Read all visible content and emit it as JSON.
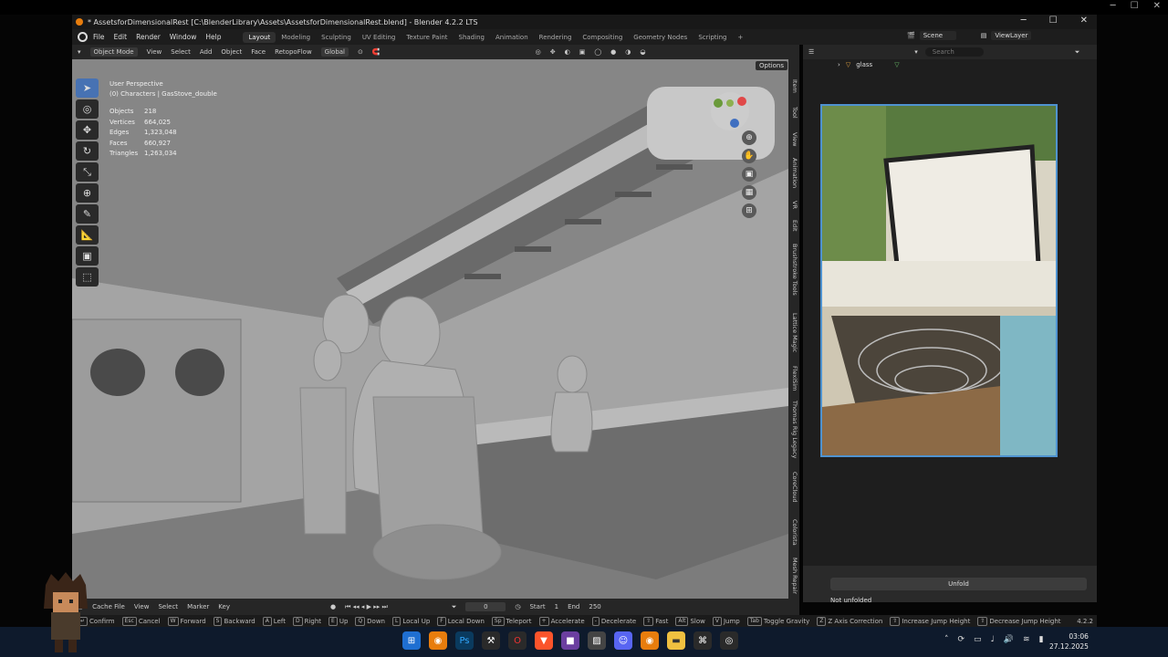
{
  "window": {
    "title": "* AssetsforDimensionalRest [C:\\BlenderLibrary\\Assets\\AssetsforDimensionalRest.blend] - Blender 4.2.2 LTS",
    "min": "─",
    "max": "☐",
    "close": "✕"
  },
  "menu": {
    "items": [
      "File",
      "Edit",
      "Render",
      "Window",
      "Help"
    ]
  },
  "workspaces": [
    "Layout",
    "Modeling",
    "Sculpting",
    "UV Editing",
    "Texture Paint",
    "Shading",
    "Animation",
    "Rendering",
    "Compositing",
    "Geometry Nodes",
    "Scripting",
    "+"
  ],
  "scene": {
    "name": "Scene",
    "view_layer": "ViewLayer"
  },
  "viewport_header": {
    "mode": "Object Mode",
    "items": [
      "View",
      "Select",
      "Add",
      "Object",
      "Face",
      "RetopoFlow"
    ],
    "transform": "Global",
    "options": "Options"
  },
  "overlay": {
    "perspective": "User Perspective",
    "collection": "(0) Characters | GasStove_double"
  },
  "stats": [
    {
      "label": "Objects",
      "value": "218"
    },
    {
      "label": "Vertices",
      "value": "664,025"
    },
    {
      "label": "Edges",
      "value": "1,323,048"
    },
    {
      "label": "Faces",
      "value": "660,927"
    },
    {
      "label": "Triangles",
      "value": "1,263,034"
    }
  ],
  "sidebar_tabs": [
    "Item",
    "Tool",
    "View",
    "Animation",
    "VR",
    "Edit",
    "Brushstroke Tools",
    "Lattice Magic",
    "FlexiSim",
    "Thomas Rig Legacy",
    "CoreCloud",
    "Colorista",
    "Mesh Repair"
  ],
  "outliner": {
    "search_placeholder": "Search",
    "item": "glass"
  },
  "properties": {
    "button": "Unfold",
    "status": "Not unfolded"
  },
  "timeline": {
    "playback": "Cache File",
    "items": [
      "View",
      "Select",
      "Marker",
      "Key"
    ],
    "current_frame": "0",
    "start_label": "Start",
    "start": "1",
    "end_label": "End",
    "end": "250"
  },
  "statusbar": [
    {
      "key": "↵",
      "label": "Confirm"
    },
    {
      "key": "Esc",
      "label": "Cancel"
    },
    {
      "key": "W",
      "label": "Forward"
    },
    {
      "key": "S",
      "label": "Backward"
    },
    {
      "key": "A",
      "label": "Left"
    },
    {
      "key": "D",
      "label": "Right"
    },
    {
      "key": "E",
      "label": "Up"
    },
    {
      "key": "Q",
      "label": "Down"
    },
    {
      "key": "L",
      "label": "Local Up"
    },
    {
      "key": "F",
      "label": "Local Down"
    },
    {
      "key": "Sp",
      "label": "Teleport"
    },
    {
      "key": "+",
      "label": "Accelerate"
    },
    {
      "key": "-",
      "label": "Decelerate"
    },
    {
      "key": "⇧",
      "label": "Fast"
    },
    {
      "key": "Alt",
      "label": "Slow"
    },
    {
      "key": "V",
      "label": "Jump"
    },
    {
      "key": "Tab",
      "label": "Toggle Gravity"
    },
    {
      "key": "Z",
      "label": "Z Axis Correction"
    },
    {
      "key": "⇧",
      "label": "Increase Jump Height"
    },
    {
      "key": "⇧",
      "label": "Decrease Jump Height"
    }
  ],
  "version": "4.2.2",
  "clock": {
    "time": "03:06",
    "date": "27.12.2025"
  }
}
